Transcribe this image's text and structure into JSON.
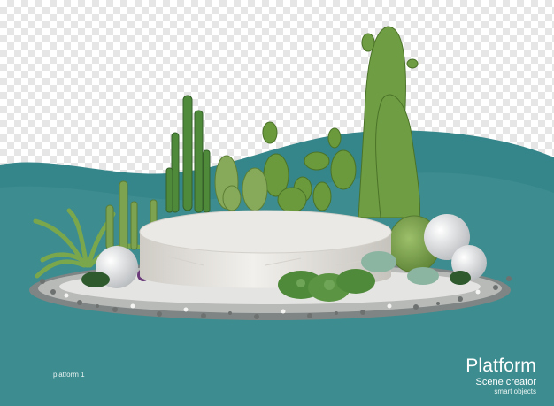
{
  "caption": {
    "label": "platform 1"
  },
  "brand": {
    "title": "Platform",
    "subtitle": "Scene creator",
    "tagline": "smart objects"
  },
  "colors": {
    "teal_back": "#35868a",
    "teal_front": "#3d8c8f",
    "cactus": "#6e9a3f",
    "cactus_dark": "#4f7a2c",
    "marble": "#e8e6e1",
    "pebble": "#9a9a98"
  }
}
